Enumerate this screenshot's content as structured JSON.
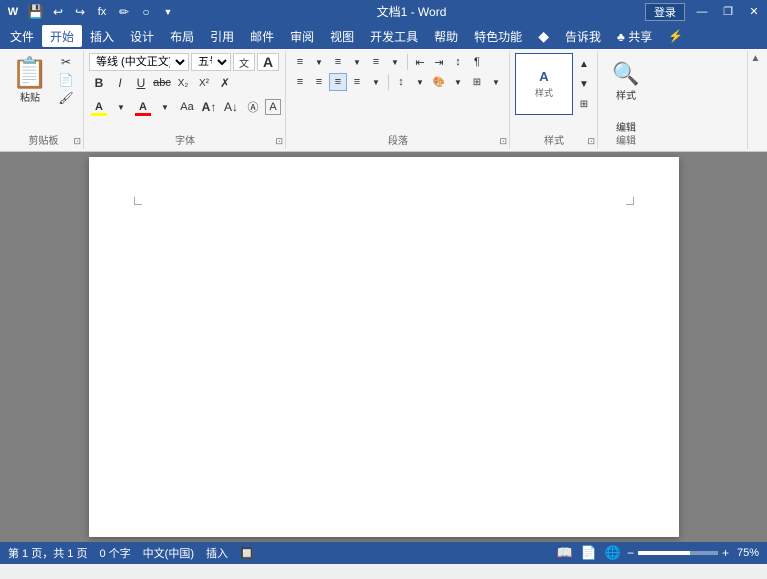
{
  "titlebar": {
    "title": "文档1 - Word",
    "login": "登录",
    "buttons": {
      "minimize": "—",
      "restore": "❐",
      "close": "✕"
    },
    "quick_access": [
      "💾",
      "↩",
      "↪",
      "fx",
      "✏",
      "○",
      "▼"
    ]
  },
  "menubar": {
    "items": [
      "文件",
      "开始",
      "插入",
      "设计",
      "布局",
      "引用",
      "邮件",
      "审阅",
      "视图",
      "开发工具",
      "帮助",
      "特色功能",
      "♦",
      "告诉我",
      "♣ 共享",
      "⚡"
    ]
  },
  "ribbon": {
    "groups": {
      "clipboard": {
        "label": "剪贴板"
      },
      "font": {
        "label": "字体",
        "name": "等线 (中文正文)",
        "size": "五号"
      },
      "paragraph": {
        "label": "段落"
      },
      "style": {
        "label": "样式"
      },
      "edit": {
        "label": "编辑"
      }
    }
  },
  "statusbar": {
    "page": "第 1 页，共 1 页",
    "words": "0 个字",
    "lang": "中文(中国)",
    "mode": "插入",
    "macro": "🔲",
    "zoom": "75%"
  }
}
